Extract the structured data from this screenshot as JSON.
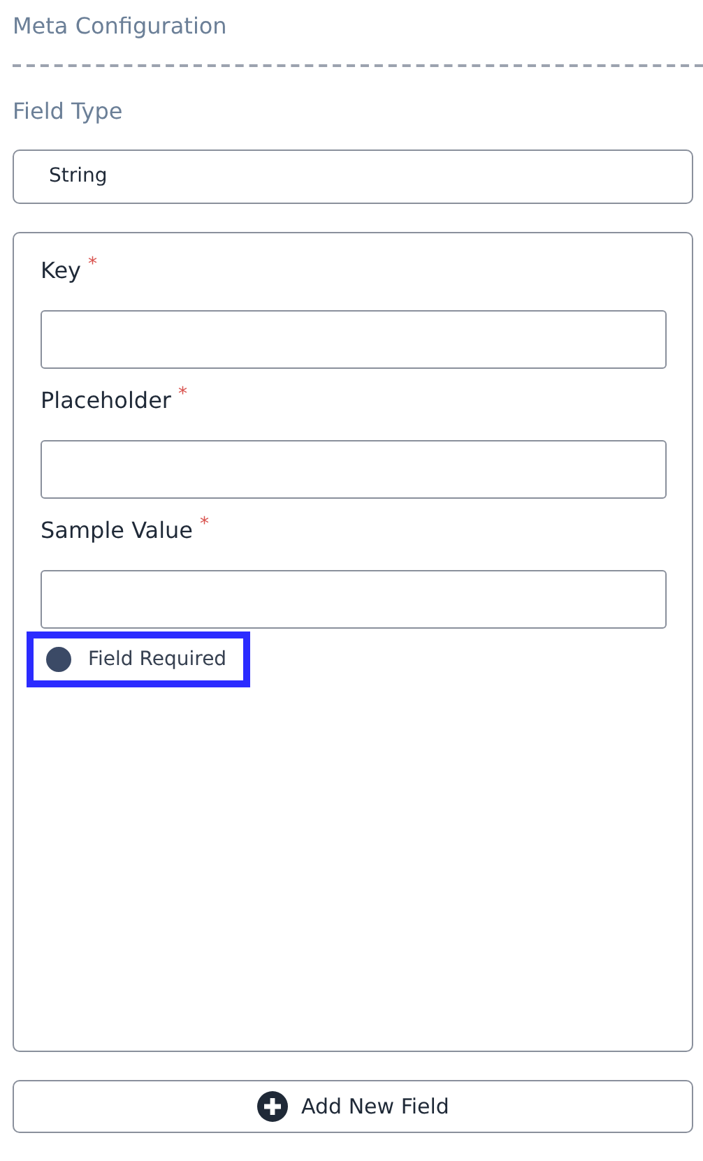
{
  "section_title": "Meta Configuration",
  "field_type": {
    "label": "Field Type",
    "value": "String"
  },
  "fields": [
    {
      "label": "Key",
      "required_mark": "*"
    },
    {
      "label": "Placeholder",
      "required_mark": "*"
    },
    {
      "label": "Sample Value",
      "required_mark": "*"
    }
  ],
  "field_required": {
    "label": "Field Required",
    "checked": true,
    "highlighted": true
  },
  "add_button": {
    "label": "Add New Field"
  }
}
